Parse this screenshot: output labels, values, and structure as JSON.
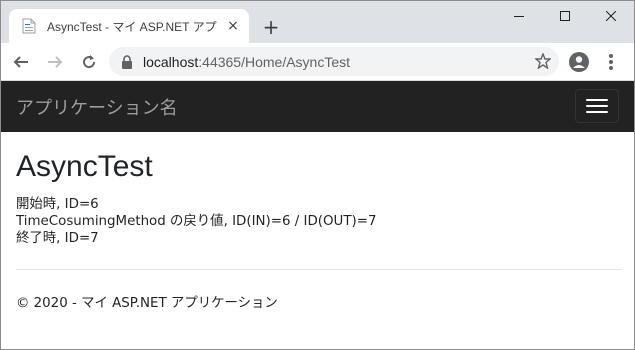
{
  "browser": {
    "tab_title": "AsyncTest - マイ ASP.NET アプリケー",
    "tab_close": "×",
    "new_tab": "+",
    "url_host": "localhost",
    "url_rest": ":44365/Home/AsyncTest",
    "window_controls": {
      "minimize": "–",
      "maximize": "☐",
      "close": "✕"
    },
    "icons": {
      "back": "arrow-left-icon",
      "forward": "arrow-right-icon",
      "reload": "reload-icon",
      "lock": "lock-icon",
      "star": "star-icon",
      "profile": "profile-icon",
      "menu": "kebab-menu-icon"
    }
  },
  "navbar": {
    "brand": "アプリケーション名",
    "toggle_icon": "hamburger-icon",
    "background": "#222222"
  },
  "main": {
    "title": "AsyncTest",
    "lines": [
      "開始時, ID=6",
      "TimeCosumingMethod の戻り値, ID(IN)=6 / ID(OUT)=7",
      "終了時, ID=7"
    ]
  },
  "footer": {
    "text": "© 2020 - マイ ASP.NET アプリケーション"
  }
}
